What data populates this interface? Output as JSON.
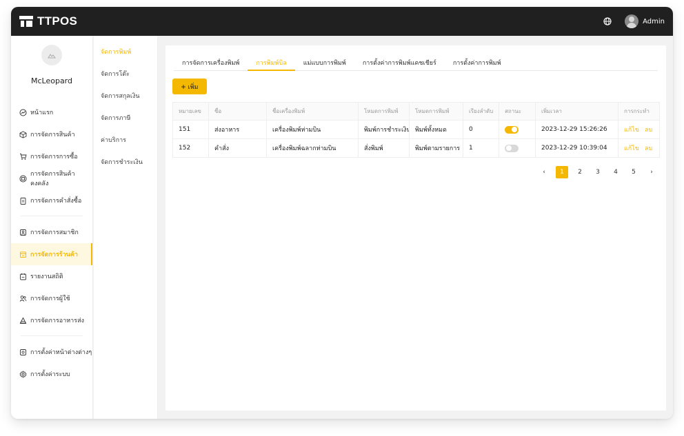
{
  "app": {
    "brand": "TTPOS"
  },
  "header": {
    "user_name": "Admin",
    "language_icon": "globe-icon"
  },
  "profile": {
    "name": "McLeopard"
  },
  "sidebar": {
    "groups": [
      [
        {
          "label": "หน้าแรก",
          "icon": "dashboard-icon"
        },
        {
          "label": "การจัดการสินค้า",
          "icon": "cube-icon"
        },
        {
          "label": "การจัดการการซื้อ",
          "icon": "cart-icon"
        },
        {
          "label": "การจัดการสินค้าคงคลัง",
          "icon": "warehouse-icon"
        },
        {
          "label": "การจัดการคำสั่งซื้อ",
          "icon": "clipboard-icon"
        }
      ],
      [
        {
          "label": "การจัดการสมาชิก",
          "icon": "member-icon"
        },
        {
          "label": "การจัดการร้านค้า",
          "icon": "store-icon",
          "active": true
        },
        {
          "label": "รายงานสถิติ",
          "icon": "report-icon"
        },
        {
          "label": "การจัดการผู้ใช้",
          "icon": "users-icon"
        },
        {
          "label": "การจัดการอาหารส่ง",
          "icon": "delivery-icon"
        }
      ],
      [
        {
          "label": "การตั้งค่าหน้าต่างต่างๆ",
          "icon": "window-settings-icon"
        },
        {
          "label": "การตั้งค่าระบบ",
          "icon": "gear-icon"
        }
      ]
    ]
  },
  "subnav": {
    "items": [
      "จัดการพิมพ์",
      "จัดการโต๊ะ",
      "จัดการสกุลเงิน",
      "จัดการภาษี",
      "ค่าบริการ",
      "จัดการชำระเงิน"
    ],
    "active_index": 0
  },
  "tabs": {
    "items": [
      "การจัดการเครื่องพิมพ์",
      "การพิมพ์บิล",
      "แม่แบบการพิมพ์",
      "การตั้งค่าการพิมพ์แคชเชียร์",
      "การตั้งค่าการพิมพ์"
    ],
    "active_index": 1
  },
  "toolbar": {
    "add_label": "เพิ่ม"
  },
  "table": {
    "columns": [
      "หมายเลข",
      "ชื่อ",
      "ชื่อเครื่องพิมพ์",
      "โหมดการพิมพ์",
      "โหมดการพิมพ์",
      "เรียงลำดับ",
      "สถานะ",
      "เพิ่มเวลา",
      "การกระทำ"
    ],
    "rows": [
      {
        "id": "151",
        "name": "ส่งอาหาร",
        "printer": "เครื่องพิมพ์ห่ามบิน",
        "mode1": "พิมพ์การชำระเงิน",
        "mode2": "พิมพ์ทั้งหมด",
        "order": "0",
        "status": true,
        "added": "2023-12-29 15:26:26"
      },
      {
        "id": "152",
        "name": "คำสั่ง",
        "printer": "เครื่องพิมพ์ฉลากห่ามบิน",
        "mode1": "สั่งพิมพ์",
        "mode2": "พิมพ์ตามรายการ",
        "order": "1",
        "status": false,
        "added": "2023-12-29 10:39:04"
      }
    ],
    "actions": {
      "edit": "แก้ไข",
      "delete": "ลบ"
    }
  },
  "pagination": {
    "pages": [
      "1",
      "2",
      "3",
      "4",
      "5"
    ],
    "current": "1",
    "prev": "‹",
    "next": "›"
  },
  "colors": {
    "accent": "#f5b800",
    "topbar": "#202020"
  }
}
